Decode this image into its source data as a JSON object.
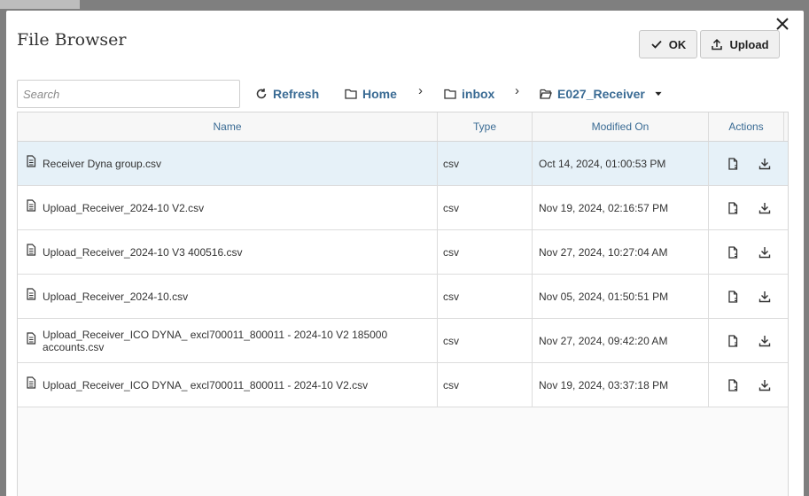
{
  "dialog": {
    "title": "File Browser",
    "ok_label": "OK",
    "upload_label": "Upload"
  },
  "toolbar": {
    "search_placeholder": "Search",
    "refresh_label": "Refresh",
    "breadcrumb": [
      "Home",
      "inbox",
      "E027_Receiver"
    ]
  },
  "table": {
    "columns": [
      "Name",
      "Type",
      "Modified On",
      "Actions"
    ],
    "rows": [
      {
        "name": "Receiver Dyna group.csv",
        "type": "csv",
        "modified": "Oct 14, 2024, 01:00:53 PM",
        "selected": true
      },
      {
        "name": "Upload_Receiver_2024-10 V2.csv",
        "type": "csv",
        "modified": "Nov 19, 2024, 02:16:57 PM"
      },
      {
        "name": "Upload_Receiver_2024-10 V3 400516.csv",
        "type": "csv",
        "modified": "Nov 27, 2024, 10:27:04 AM"
      },
      {
        "name": "Upload_Receiver_2024-10.csv",
        "type": "csv",
        "modified": "Nov 05, 2024, 01:50:51 PM"
      },
      {
        "name": "Upload_Receiver_ICO DYNA_ excl700011_800011 - 2024-10 V2 185000 accounts.csv",
        "type": "csv",
        "modified": "Nov 27, 2024, 09:42:20 AM"
      },
      {
        "name": "Upload_Receiver_ICO DYNA_ excl700011_800011 - 2024-10 V2.csv",
        "type": "csv",
        "modified": "Nov 19, 2024, 03:37:18 PM"
      }
    ]
  },
  "colors": {
    "accent": "#3a6b94",
    "selected_row": "#e6f1f8"
  }
}
